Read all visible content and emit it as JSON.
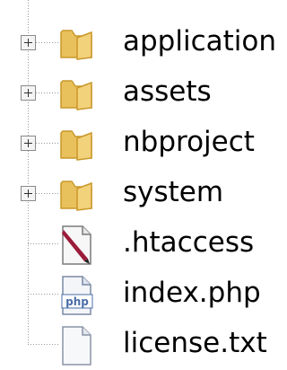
{
  "tree": {
    "items": [
      {
        "label": "application",
        "icon": "folder-icon",
        "expandable": true
      },
      {
        "label": "assets",
        "icon": "folder-icon",
        "expandable": true
      },
      {
        "label": "nbproject",
        "icon": "folder-icon",
        "expandable": true
      },
      {
        "label": "system",
        "icon": "folder-icon",
        "expandable": true
      },
      {
        "label": ".htaccess",
        "icon": "htaccess-file-icon",
        "expandable": false
      },
      {
        "label": "index.php",
        "icon": "php-file-icon",
        "expandable": false
      },
      {
        "label": "license.txt",
        "icon": "text-file-icon",
        "expandable": false
      }
    ],
    "php_badge": "php"
  },
  "colors": {
    "folder": "#e9c15c",
    "folder_dark": "#c9982a",
    "guide": "#9a9a9a",
    "php_blue": "#4a6ea8"
  }
}
